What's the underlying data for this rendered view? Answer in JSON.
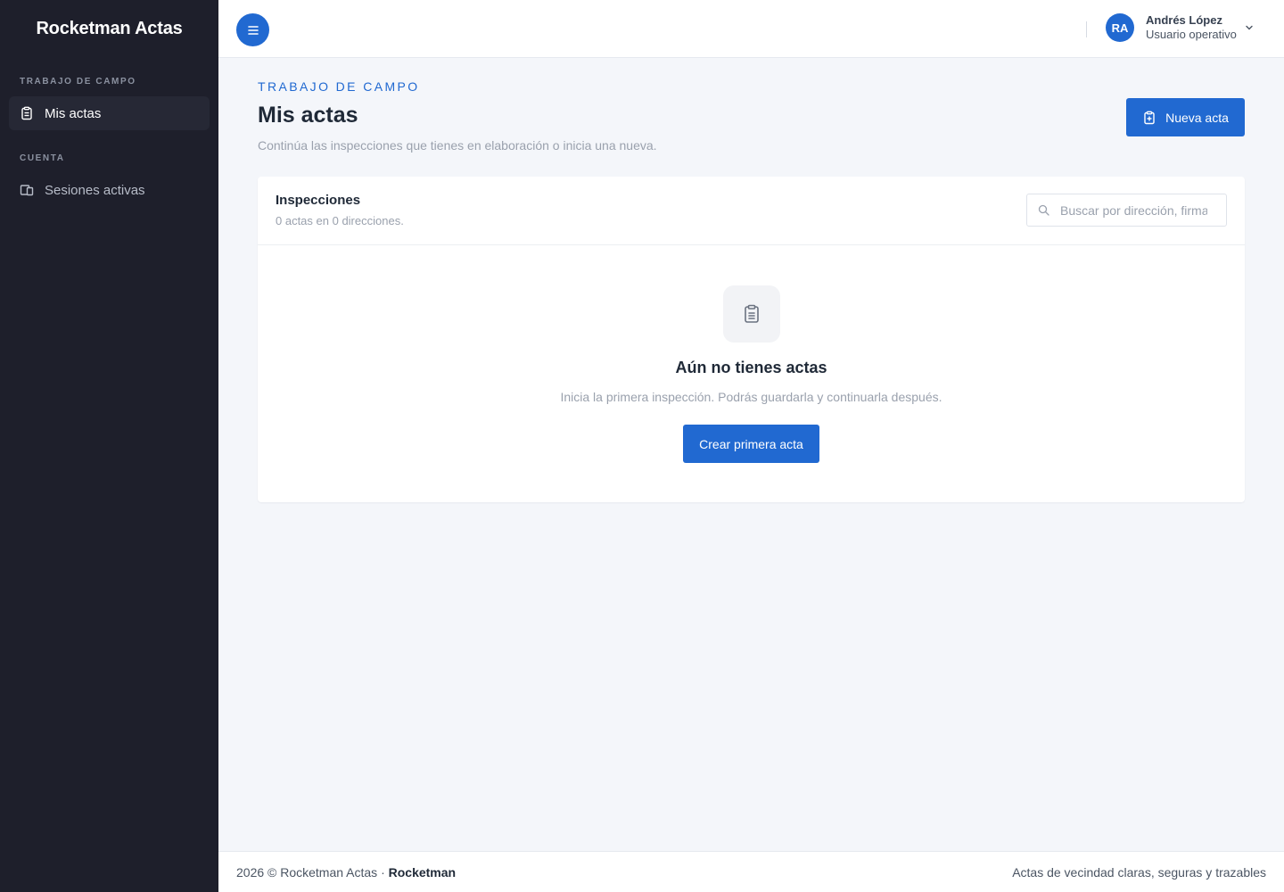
{
  "sidebar": {
    "brand": "Rocketman Actas",
    "sections": [
      {
        "label": "TRABAJO DE CAMPO",
        "items": [
          {
            "label": "Mis actas",
            "icon": "clipboard-icon",
            "active": true
          }
        ]
      },
      {
        "label": "CUENTA",
        "items": [
          {
            "label": "Sesiones activas",
            "icon": "devices-icon",
            "active": false
          }
        ]
      }
    ]
  },
  "topbar": {
    "menu_icon": "menu-icon",
    "user": {
      "initials": "RA",
      "name": "Andrés López",
      "role": "Usuario operativo"
    }
  },
  "page": {
    "eyebrow": "TRABAJO DE CAMPO",
    "title": "Mis actas",
    "subtitle": "Continúa las inspecciones que tienes en elaboración o inicia una nueva.",
    "new_button": "Nueva acta"
  },
  "card": {
    "title": "Inspecciones",
    "summary": "0 actas en 0 direcciones.",
    "search_placeholder": "Buscar por dirección, firmante",
    "empty": {
      "title": "Aún no tienes actas",
      "text": "Inicia la primera inspección. Podrás guardarla y continuarla después.",
      "button": "Crear primera acta"
    }
  },
  "footer": {
    "left_text": "2026 © Rocketman Actas · ",
    "left_brand": "Rocketman",
    "right_text": "Actas de vecindad claras, seguras y trazables"
  },
  "colors": {
    "primary": "#2169d1",
    "sidebar": "#1e1f2b",
    "background": "#f4f6fa"
  }
}
